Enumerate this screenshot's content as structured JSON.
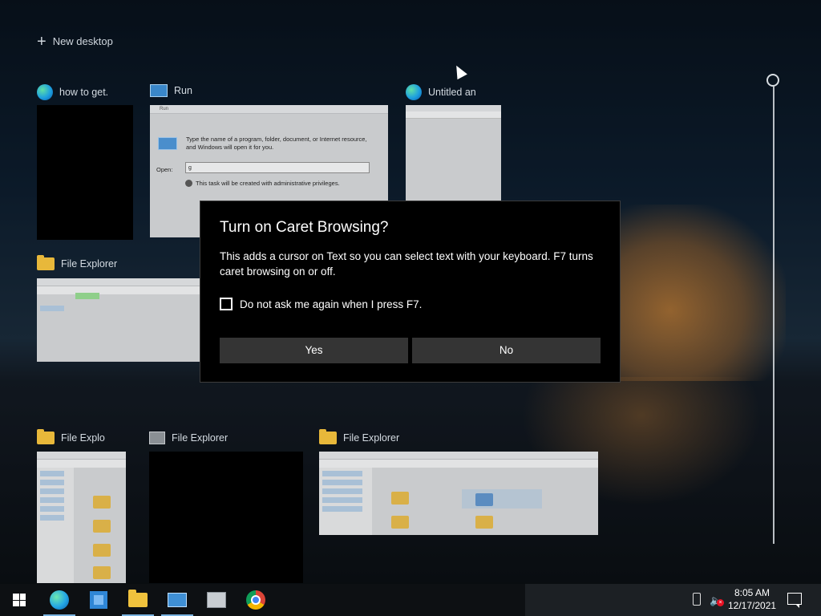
{
  "new_desktop": {
    "label": "New desktop"
  },
  "windows": [
    {
      "title": "how to get.",
      "icon": "edge-icon"
    },
    {
      "title": "Run",
      "icon": "run-icon"
    },
    {
      "title": "Untitled an",
      "icon": "edge-icon"
    },
    {
      "title": "File Explorer",
      "icon": "folder-icon"
    },
    {
      "title": "File Explo",
      "icon": "folder-icon"
    },
    {
      "title": "File Explorer",
      "icon": "explorer-icon"
    },
    {
      "title": "File Explorer",
      "icon": "folder-icon"
    }
  ],
  "run_thumbnail": {
    "header": "Run",
    "description": "Type the name of a program, folder, document, or Internet resource, and Windows will open it for you.",
    "open_label": "Open:",
    "open_value": "g",
    "admin_note": "This task will be created with administrative privileges."
  },
  "dialog": {
    "title": "Turn on Caret Browsing?",
    "message": "This adds a cursor on Text so you can select text with your keyboard. F7 turns caret browsing on or off.",
    "checkbox_label": "Do not ask me again when I press F7.",
    "checkbox_checked": false,
    "yes_label": "Yes",
    "no_label": "No"
  },
  "taskbar": {
    "icons": [
      "windows-start-icon",
      "edge-icon",
      "store-icon",
      "file-explorer-icon",
      "run-icon",
      "mmc-icon",
      "chrome-icon"
    ],
    "clock_time": "8:05 AM",
    "clock_date": "12/17/2021"
  },
  "colors": {
    "dialog_bg": "#000000",
    "button_bg": "#343434",
    "taskbar_bg": "#0d1013"
  }
}
